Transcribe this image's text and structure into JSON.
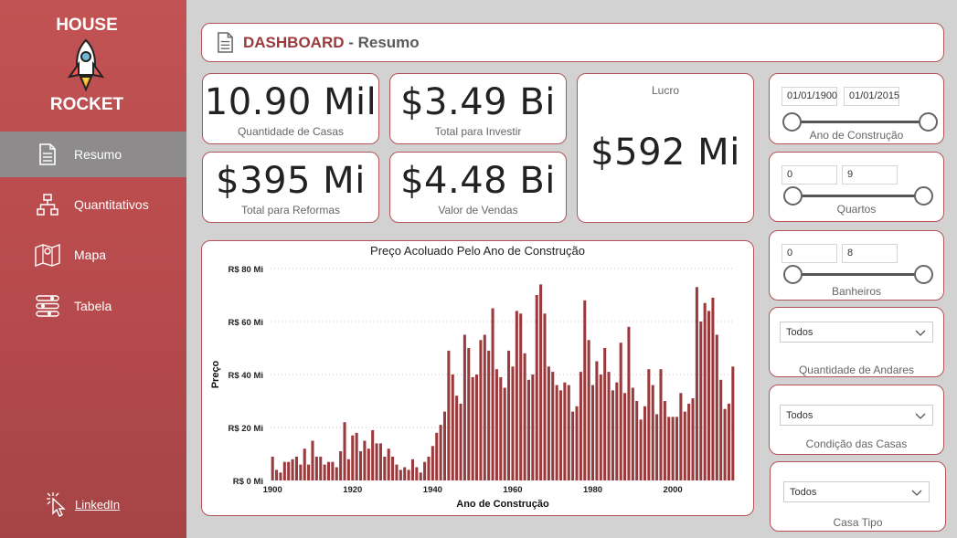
{
  "sidebar": {
    "brand_top": "HOUSE",
    "brand_bottom": "ROCKET",
    "items": [
      {
        "label": "Resumo",
        "icon": "document-icon",
        "active": true
      },
      {
        "label": "Quantitativos",
        "icon": "hierarchy-icon",
        "active": false
      },
      {
        "label": "Mapa",
        "icon": "map-icon",
        "active": false
      },
      {
        "label": "Tabela",
        "icon": "sliders-icon",
        "active": false
      }
    ],
    "linkedin": "LinkedIn"
  },
  "header": {
    "title_main": "DASHBOARD",
    "title_sub": " - Resumo"
  },
  "kpis": {
    "casas": {
      "value": "10.90 Mil",
      "label": "Quantidade de Casas"
    },
    "investir": {
      "value": "$3.49 Bi",
      "label": "Total para Investir"
    },
    "reformas": {
      "value": "$395 Mi",
      "label": "Total para Reformas"
    },
    "vendas": {
      "value": "$4.48 Bi",
      "label": "Valor de Vendas"
    },
    "lucro": {
      "value": "$592 Mi",
      "label": "Lucro"
    }
  },
  "filters": {
    "ano": {
      "from": "01/01/1900",
      "to": "01/01/2015",
      "title": "Ano de Construção"
    },
    "quartos": {
      "from": "0",
      "to": "9",
      "title": "Quartos"
    },
    "banheiros": {
      "from": "0",
      "to": "8",
      "title": "Banheiros"
    },
    "andares": {
      "value": "Todos",
      "title": "Quantidade de Andares"
    },
    "condicao": {
      "value": "Todos",
      "title": "Condição das Casas"
    },
    "tipo": {
      "value": "Todos",
      "title": "Casa Tipo"
    }
  },
  "colors": {
    "accent": "#9b3a3c",
    "bar": "#9b3a3c",
    "sidebar": "#c25253"
  },
  "chart_data": {
    "type": "bar",
    "title": "Preço Acoluado Pelo Ano de Construção",
    "xlabel": "Ano de Construção",
    "ylabel": "Preço",
    "yticks": [
      "R$ 0 Mi",
      "R$ 20 Mi",
      "R$ 40 Mi",
      "R$ 60 Mi",
      "R$ 80 Mi"
    ],
    "xticks": [
      "1900",
      "1920",
      "1940",
      "1960",
      "1980",
      "2000"
    ],
    "ylim": [
      0,
      80
    ],
    "xlim": [
      1900,
      2015
    ],
    "grid": true,
    "x": [
      1900,
      1901,
      1902,
      1903,
      1904,
      1905,
      1906,
      1907,
      1908,
      1909,
      1910,
      1911,
      1912,
      1913,
      1914,
      1915,
      1916,
      1917,
      1918,
      1919,
      1920,
      1921,
      1922,
      1923,
      1924,
      1925,
      1926,
      1927,
      1928,
      1929,
      1930,
      1931,
      1932,
      1933,
      1934,
      1935,
      1936,
      1937,
      1938,
      1939,
      1940,
      1941,
      1942,
      1943,
      1944,
      1945,
      1946,
      1947,
      1948,
      1949,
      1950,
      1951,
      1952,
      1953,
      1954,
      1955,
      1956,
      1957,
      1958,
      1959,
      1960,
      1961,
      1962,
      1963,
      1964,
      1965,
      1966,
      1967,
      1968,
      1969,
      1970,
      1971,
      1972,
      1973,
      1974,
      1975,
      1976,
      1977,
      1978,
      1979,
      1980,
      1981,
      1982,
      1983,
      1984,
      1985,
      1986,
      1987,
      1988,
      1989,
      1990,
      1991,
      1992,
      1993,
      1994,
      1995,
      1996,
      1997,
      1998,
      1999,
      2000,
      2001,
      2002,
      2003,
      2004,
      2005,
      2006,
      2007,
      2008,
      2009,
      2010,
      2011,
      2012,
      2013,
      2014,
      2015
    ],
    "values": [
      9,
      4,
      3,
      7,
      7,
      8,
      9,
      6,
      12,
      6,
      15,
      9,
      9,
      6,
      7,
      7,
      5,
      11,
      22,
      8,
      17,
      18,
      11,
      15,
      12,
      19,
      14,
      14,
      9,
      12,
      9,
      6,
      4,
      5,
      4,
      8,
      5,
      3,
      7,
      9,
      13,
      18,
      21,
      26,
      49,
      40,
      32,
      29,
      55,
      50,
      39,
      40,
      53,
      55,
      49,
      65,
      42,
      39,
      35,
      49,
      43,
      64,
      63,
      48,
      38,
      40,
      70,
      74,
      63,
      43,
      41,
      36,
      34,
      37,
      36,
      26,
      28,
      41,
      68,
      53,
      36,
      45,
      40,
      50,
      41,
      34,
      37,
      52,
      33,
      58,
      35,
      30,
      23,
      28,
      42,
      36,
      25,
      42,
      30,
      24,
      24,
      24,
      33,
      26,
      29,
      31,
      73,
      60,
      67,
      64,
      69,
      55,
      38,
      27,
      29,
      43
    ]
  }
}
